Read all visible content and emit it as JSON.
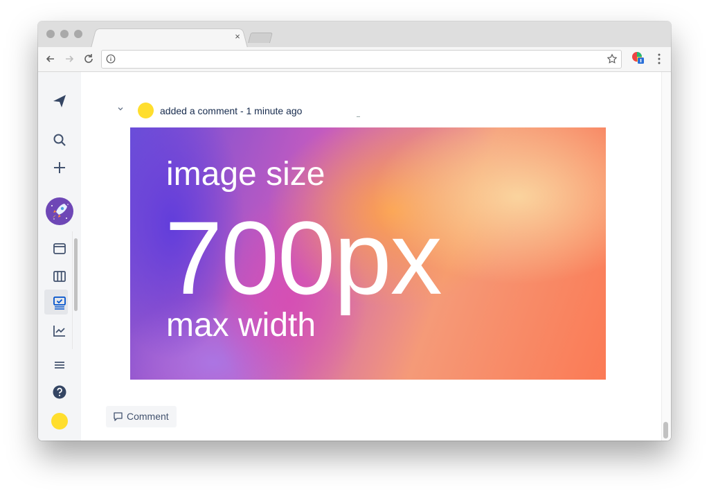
{
  "browser": {
    "tab_close_glyph": "×",
    "colors": {
      "traffic_light": "#a9a9a9",
      "tab_strip": "#dedede"
    }
  },
  "sidebar": {
    "items": [
      {
        "icon": "paper-plane-logo-icon"
      },
      {
        "icon": "search-icon"
      },
      {
        "icon": "plus-icon"
      },
      {
        "icon": "project-rocket-avatar"
      },
      {
        "icon": "backlog-card-icon"
      },
      {
        "icon": "board-columns-icon"
      },
      {
        "icon": "active-sprint-icon"
      },
      {
        "icon": "reports-chart-icon"
      },
      {
        "icon": "menu-icon"
      },
      {
        "icon": "help-icon"
      },
      {
        "icon": "user-avatar"
      }
    ]
  },
  "comment": {
    "meta": "added a comment - 1 minute ago",
    "avatar_color": "#ffde2e"
  },
  "image": {
    "line1": "image size",
    "line2": "700px",
    "line3": "max width"
  },
  "actions": {
    "comment_label": "Comment"
  }
}
